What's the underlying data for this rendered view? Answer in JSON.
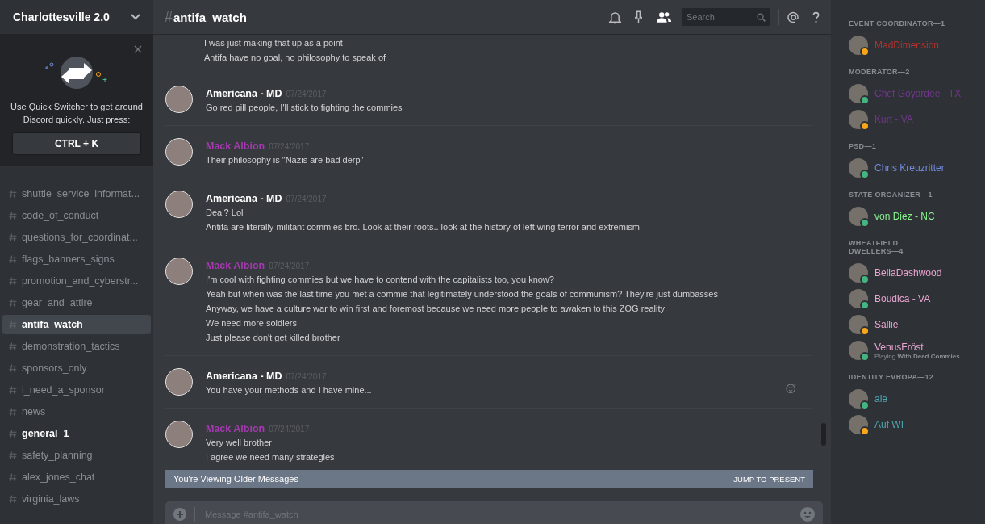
{
  "server": {
    "name": "Charlottesville 2.0"
  },
  "quick_switcher": {
    "text": "Use Quick Switcher to get around Discord quickly. Just press:",
    "shortcut": "CTRL + K"
  },
  "channels": [
    {
      "name": "shuttle_service_informat...",
      "selected": false,
      "unread": false
    },
    {
      "name": "code_of_conduct",
      "selected": false,
      "unread": false
    },
    {
      "name": "questions_for_coordinat...",
      "selected": false,
      "unread": false
    },
    {
      "name": "flags_banners_signs",
      "selected": false,
      "unread": false
    },
    {
      "name": "promotion_and_cyberstr...",
      "selected": false,
      "unread": false
    },
    {
      "name": "gear_and_attire",
      "selected": false,
      "unread": false
    },
    {
      "name": "antifa_watch",
      "selected": true,
      "unread": false
    },
    {
      "name": "demonstration_tactics",
      "selected": false,
      "unread": false
    },
    {
      "name": "sponsors_only",
      "selected": false,
      "unread": false
    },
    {
      "name": "i_need_a_sponsor",
      "selected": false,
      "unread": false
    },
    {
      "name": "news",
      "selected": false,
      "unread": false
    },
    {
      "name": "general_1",
      "selected": false,
      "unread": true
    },
    {
      "name": "safety_planning",
      "selected": false,
      "unread": false
    },
    {
      "name": "alex_jones_chat",
      "selected": false,
      "unread": false
    },
    {
      "name": "virginia_laws",
      "selected": false,
      "unread": false
    }
  ],
  "header": {
    "hash": "#",
    "channel": "antifa_watch",
    "search_placeholder": "Search"
  },
  "messages": [
    {
      "lines": [
        "I was just making that up as a point",
        "Antifa have no goal, no philosophy to speak of"
      ]
    },
    {
      "author": "Americana - MD",
      "color": "#ffffff",
      "timestamp": "07/24/2017",
      "lines": [
        "Go red pill people, I'll stick to fighting the commies"
      ]
    },
    {
      "author": "Mack Albion",
      "color": "#a53ab0",
      "timestamp": "07/24/2017",
      "lines": [
        "Their philosophy is \"Nazis are bad derp\""
      ]
    },
    {
      "author": "Americana - MD",
      "color": "#ffffff",
      "timestamp": "07/24/2017",
      "lines": [
        "Deal? Lol",
        "Antifa are literally militant commies bro. Look at their roots.. look at the history of left wing terror and extremism"
      ]
    },
    {
      "author": "Mack Albion",
      "color": "#a53ab0",
      "timestamp": "07/24/2017",
      "lines": [
        "I'm cool with fighting commies but we have to contend with the capitalists too, you know?",
        "Yeah but when was the last time you met a commie that legitimately understood the goals of communism? They're just dumbasses",
        "Anyway, we have a culture war to win first and foremost because we need more people to awaken to this ZOG reality",
        "We need more soldiers",
        "Just please don't get killed brother"
      ]
    },
    {
      "author": "Americana - MD",
      "color": "#ffffff",
      "timestamp": "07/24/2017",
      "lines": [
        "You have your methods and I have mine..."
      ],
      "reaction_button": true
    },
    {
      "author": "Mack Albion",
      "color": "#a53ab0",
      "timestamp": "07/24/2017",
      "lines": [
        "Very well brother",
        "I agree we need many strategies"
      ]
    }
  ],
  "older_banner": {
    "text": "You're Viewing Older Messages",
    "action": "JUMP TO PRESENT"
  },
  "composer": {
    "placeholder": "Message #antifa_watch"
  },
  "member_groups": [
    {
      "title": "EVENT COORDINATOR—1",
      "members": [
        {
          "name": "MadDimension",
          "color": "#b0322d",
          "idle": true
        }
      ]
    },
    {
      "title": "MODERATOR—2",
      "members": [
        {
          "name": "Chef Goyardee - TX",
          "color": "#71368a",
          "idle": false
        },
        {
          "name": "Kurt - VA",
          "color": "#71368a",
          "idle": true
        }
      ]
    },
    {
      "title": "PSD—1",
      "members": [
        {
          "name": "Chris Kreuzritter",
          "color": "#7289da",
          "idle": false
        }
      ]
    },
    {
      "title": "STATE ORGANIZER—1",
      "members": [
        {
          "name": "von Diez - NC",
          "color": "#88f28e",
          "idle": false
        }
      ]
    },
    {
      "title": "WHEATFIELD DWELLERS—4",
      "members": [
        {
          "name": "BellaDashwood",
          "color": "#e8a4cf",
          "idle": false
        },
        {
          "name": "Boudica - VA",
          "color": "#e8a4cf",
          "idle": false
        },
        {
          "name": "Sallie",
          "color": "#e8a4cf",
          "idle": true
        },
        {
          "name": "VenusFröst",
          "color": "#e8a4cf",
          "idle": false,
          "activity": "Playing **With Dead Commies**"
        }
      ]
    },
    {
      "title": "IDENTITY EVROPA—12",
      "members": [
        {
          "name": "ale",
          "color": "#4fa4b0",
          "idle": false
        },
        {
          "name": "Auf WI",
          "color": "#4fa4b0",
          "idle": true
        }
      ]
    }
  ]
}
